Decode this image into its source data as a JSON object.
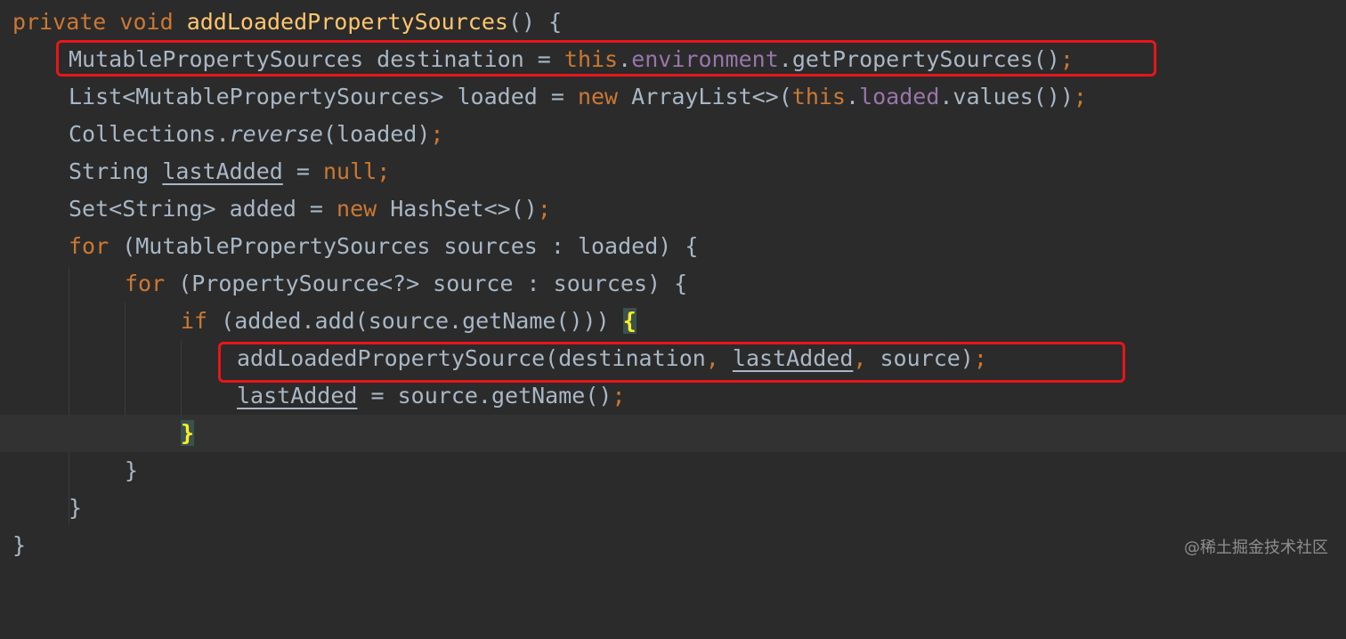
{
  "editor": {
    "line1": {
      "kw_private": "private",
      "kw_void": "void",
      "method_name": "addLoadedPropertySources",
      "rest": "() {"
    },
    "line2": {
      "p1": "MutablePropertySources destination = ",
      "kw_this": "this",
      "dot": ".",
      "field": "environment",
      "p2": ".getPropertySources()",
      "semi": ";"
    },
    "line3": {
      "p1": "List<MutablePropertySources> loaded = ",
      "kw_new": "new",
      "p2": " ArrayList<>(",
      "kw_this": "this",
      "dot": ".",
      "field": "loaded",
      "p3": ".values())",
      "semi": ";"
    },
    "line4": {
      "p1": "Collections.",
      "italic": "reverse",
      "p2": "(loaded)",
      "semi": ";"
    },
    "line5": {
      "p1": "String ",
      "var": "lastAdded",
      "p2": " = ",
      "kw_null": "null",
      "semi": ";"
    },
    "line6": {
      "p1": "Set<String> added = ",
      "kw_new": "new",
      "p2": " HashSet<>()",
      "semi": ";"
    },
    "line7": {
      "kw_for": "for",
      "p1": " (MutablePropertySources sources : loaded) {"
    },
    "line8": {
      "kw_for": "for",
      "p1": " (PropertySource<?> source : sources) {"
    },
    "line9": {
      "kw_if": "if",
      "p1": " (added.add(source.getName())) ",
      "brace": "{"
    },
    "line10": {
      "p1": "addLoadedPropertySource(destination",
      "comma1": ",",
      "sp1": " ",
      "var": "lastAdded",
      "comma2": ",",
      "p2": " source)",
      "semi": ";"
    },
    "line11": {
      "var": "lastAdded",
      "p1": " = source.getName()",
      "semi": ";"
    },
    "line12": {
      "brace": "}"
    },
    "line13": {
      "brace": "}"
    },
    "line14": {
      "brace": "}"
    },
    "line15": {
      "brace": "}"
    }
  },
  "watermark": "@稀土掘金技术社区",
  "colors": {
    "background": "#2b2b2b",
    "current_line": "#323232",
    "text": "#a9b7c6",
    "keyword": "#cc7832",
    "method_declaration": "#ffc66d",
    "field": "#9876aa",
    "brace_match": "#ffef28",
    "highlight_box": "#e8151b"
  }
}
